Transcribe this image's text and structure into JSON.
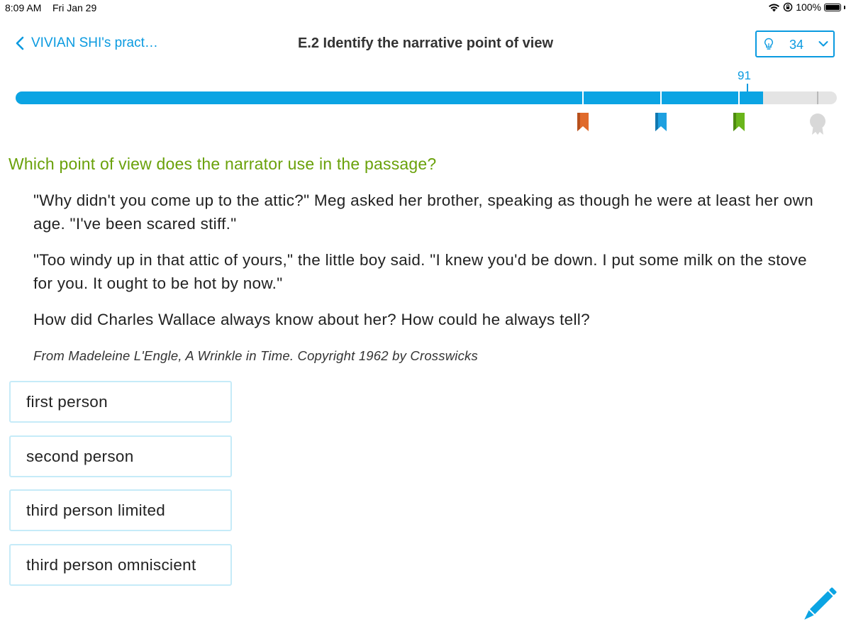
{
  "status_bar": {
    "time": "8:09 AM",
    "date": "Fri Jan 29",
    "battery": "100%",
    "icons": [
      "wifi-icon",
      "orientation-lock-icon",
      "battery-icon"
    ]
  },
  "header": {
    "back_label": "VIVIAN SHI's pract…",
    "title": "E.2 Identify the narrative point of view",
    "hints": {
      "count": "34",
      "icons": [
        "lightbulb-icon",
        "chevron-down-icon"
      ]
    }
  },
  "progress": {
    "score": "91",
    "max": 100,
    "milestones": [
      {
        "name": "bronze",
        "color": "#e06a2b",
        "reached": true
      },
      {
        "name": "blue",
        "color": "#1ea0e0",
        "reached": true
      },
      {
        "name": "green",
        "color": "#6ab51b",
        "reached": true
      },
      {
        "name": "grey",
        "color": "#d8d8d8",
        "reached": false
      }
    ],
    "colors": {
      "fill": "#0ba4e3",
      "track": "#e4e4e4"
    }
  },
  "question": {
    "prompt": "Which point of view does the narrator use in the passage?",
    "passage": [
      "\"Why didn't you come up to the attic?\" Meg asked her brother, speaking as though he were at least her own age. \"I've been scared stiff.\"",
      "\"Too windy up in that attic of yours,\" the little boy said. \"I knew you'd be down. I put some milk on the stove for you. It ought to be hot by now.\"",
      "How did Charles Wallace always know about her? How could he always tell?"
    ],
    "citation": "From Madeleine L'Engle, A Wrinkle in Time. Copyright 1962 by Crosswicks"
  },
  "answers": [
    {
      "label": "first person"
    },
    {
      "label": "second person"
    },
    {
      "label": "third person limited"
    },
    {
      "label": "third person omniscient"
    }
  ],
  "tools": {
    "scratchpad_icon": "pencil-icon"
  },
  "colors": {
    "accent": "#0a9ae0",
    "question_green": "#6aa10a",
    "answer_border": "#c6ebf8"
  }
}
